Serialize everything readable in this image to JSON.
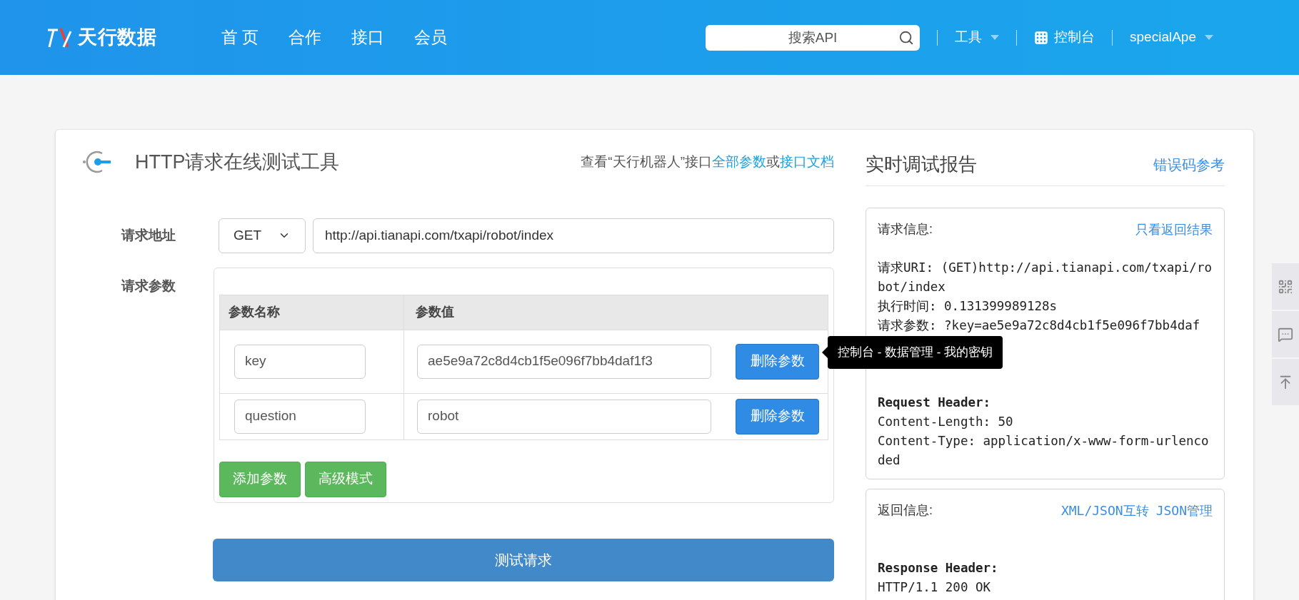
{
  "header": {
    "logo": "天行数据",
    "nav": [
      {
        "label": "首 页"
      },
      {
        "label": "合作"
      },
      {
        "label": "接口"
      },
      {
        "label": "会员"
      }
    ],
    "search": {
      "placeholder": "搜索API"
    },
    "tools": "工具",
    "console": "控制台",
    "user": "specialApe"
  },
  "tool": {
    "title": "HTTP请求在线测试工具",
    "links": [
      {
        "kind": "text",
        "text": "查看“天行机器人”接口"
      },
      {
        "kind": "link",
        "text": "全部参数"
      },
      {
        "kind": "text",
        "text": "或"
      },
      {
        "kind": "link",
        "text": "接口文档"
      }
    ],
    "url_label": "请求地址",
    "method": "GET",
    "url": "http://api.tianapi.com/txapi/robot/index",
    "params_label": "请求参数",
    "columns": [
      "参数名称",
      "参数值"
    ],
    "params": [
      {
        "name": "key",
        "value": "ae5e9a72c8d4cb1f5e096f7bb4daf1f3",
        "delete": "删除参数"
      },
      {
        "name": "question",
        "value": "robot",
        "delete": "删除参数"
      }
    ],
    "tooltip": "控制台 - 数据管理 - 我的密钥",
    "add_button": "添加参数",
    "advanced_button": "高级模式",
    "submit": "测试请求"
  },
  "report": {
    "title": "实时调试报告",
    "link": "错误码参考",
    "request": {
      "label": "请求信息:",
      "links": [
        "只看返回结果"
      ],
      "lines": [
        {
          "kind": "gap"
        },
        {
          "kind": "text",
          "text": "请求URI: (GET)http://api.tianapi.com/txapi/robot/index"
        },
        {
          "kind": "text",
          "text": "执行时间: 0.131399989128s"
        },
        {
          "kind": "text",
          "text": "请求参数: ?key=ae5e9a72c8d4cb1f5e096f7bb4daf"
        },
        {
          "kind": "gap"
        },
        {
          "kind": "gap"
        },
        {
          "kind": "gap"
        },
        {
          "kind": "bold",
          "text": "Request Header:"
        },
        {
          "kind": "text",
          "text": "Content-Length: 50"
        },
        {
          "kind": "text",
          "text": "Content-Type: application/x-www-form-urlencoded"
        }
      ]
    },
    "response": {
      "label": "返回信息:",
      "links": [
        "XML/JSON互转",
        "JSON管理"
      ],
      "lines": [
        {
          "kind": "gap"
        },
        {
          "kind": "gap"
        },
        {
          "kind": "bold",
          "text": "Response Header:"
        },
        {
          "kind": "text",
          "text": "HTTP/1.1 200 OK"
        }
      ]
    }
  }
}
